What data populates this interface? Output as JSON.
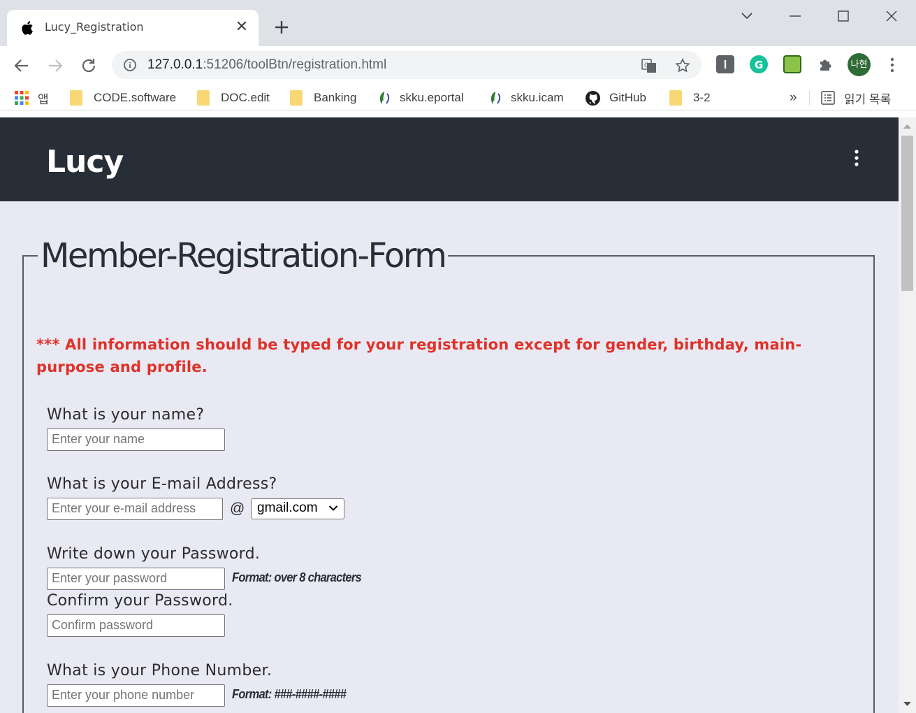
{
  "browser": {
    "tab_title": "Lucy_Registration",
    "tab_close": "✕",
    "url_host": "127.0.0.1",
    "url_rest": ":51206/toolBtn/registration.html",
    "profile_initials": "나현",
    "bookmarks": [
      {
        "label": "앱",
        "icon": "apps-grid-icon"
      },
      {
        "label": "CODE.software",
        "icon": "folder-icon"
      },
      {
        "label": "DOC.edit",
        "icon": "folder-icon"
      },
      {
        "label": "Banking",
        "icon": "folder-icon"
      },
      {
        "label": "skku.eportal",
        "icon": "skku-icon"
      },
      {
        "label": "skku.icam",
        "icon": "skku-icon"
      },
      {
        "label": "GitHub",
        "icon": "github-icon"
      },
      {
        "label": "3-2",
        "icon": "folder-icon"
      }
    ],
    "more_bookmarks": "»",
    "reading_list": "읽기 목록"
  },
  "site": {
    "logo": "Lucy"
  },
  "form": {
    "legend": "Member-Registration-Form",
    "notice": "*** All information should be typed for your registration except for gender, birthday, main-purpose and profile.",
    "name": {
      "label": "What is your name?",
      "placeholder": "Enter your name"
    },
    "email": {
      "label": "What is your E-mail Address?",
      "placeholder": "Enter your e-mail address",
      "at": "@",
      "domain": "gmail.com"
    },
    "password": {
      "label": "Write down your Password.",
      "placeholder": "Enter your password",
      "hint": "Format: over 8 characters"
    },
    "confirm": {
      "label": "Confirm your Password.",
      "placeholder": "Confirm password"
    },
    "phone": {
      "label": "What is your Phone Number.",
      "placeholder": "Enter your phone number",
      "hint": "Format: ###-####-####"
    }
  },
  "colors": {
    "header_bg": "#272e37",
    "page_bg": "#e8e9f3",
    "notice_red": "#e03127"
  }
}
